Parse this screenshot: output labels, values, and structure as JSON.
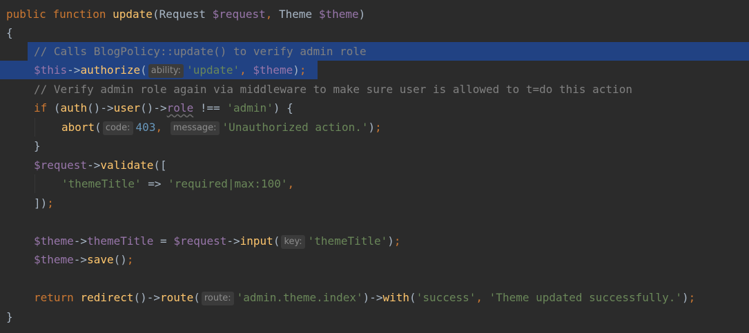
{
  "editor": {
    "lines": {
      "l1": {
        "kw_public": "public",
        "kw_function": "function",
        "fn_update": "update",
        "open_paren": "(",
        "type_request": "Request",
        "var_request": "$request",
        "comma": ",",
        "type_theme": "Theme",
        "var_theme": "$theme",
        "close_paren": ")"
      },
      "l2": {
        "brace": "{"
      },
      "l3": {
        "comment": "// Calls BlogPolicy::update() to verify admin role"
      },
      "l4": {
        "var_this": "$this",
        "arrow": "->",
        "fn_authorize": "authorize",
        "open": "(",
        "hint_ability": "ability:",
        "str_update": "'update'",
        "comma": ",",
        "var_theme": "$theme",
        "close": ")",
        "semi": ";"
      },
      "l5": {
        "comment": "// Verify admin role again via middleware to make sure user is allowed to t=do this action"
      },
      "l6": {
        "kw_if": "if",
        "open": "(",
        "fn_auth": "auth",
        "parens1": "()",
        "arrow1": "->",
        "fn_user": "user",
        "parens2": "()",
        "arrow2": "->",
        "prop_role": "role",
        "op": "!==",
        "str_admin": "'admin'",
        "close": ")",
        "brace": "{"
      },
      "l7": {
        "fn_abort": "abort",
        "open": "(",
        "hint_code": "code:",
        "num_403": "403",
        "comma": ",",
        "hint_message": "message:",
        "str_msg": "'Unauthorized action.'",
        "close": ")",
        "semi": ";"
      },
      "l8": {
        "brace": "}"
      },
      "l9": {
        "var_request": "$request",
        "arrow": "->",
        "fn_validate": "validate",
        "open": "(["
      },
      "l10": {
        "str_key": "'themeTitle'",
        "op": "=>",
        "str_val": "'required|max:100'",
        "comma": ","
      },
      "l11": {
        "close": "])",
        "semi": ";"
      },
      "l13": {
        "var_theme": "$theme",
        "arrow1": "->",
        "prop_title": "themeTitle",
        "eq": "=",
        "var_request": "$request",
        "arrow2": "->",
        "fn_input": "input",
        "open": "(",
        "hint_key": "key:",
        "str_key": "'themeTitle'",
        "close": ")",
        "semi": ";"
      },
      "l14": {
        "var_theme": "$theme",
        "arrow": "->",
        "fn_save": "save",
        "parens": "()",
        "semi": ";"
      },
      "l16": {
        "kw_return": "return",
        "fn_redirect": "redirect",
        "parens": "()",
        "arrow1": "->",
        "fn_route": "route",
        "open1": "(",
        "hint_route": "route:",
        "str_route": "'admin.theme.index'",
        "close1": ")",
        "arrow2": "->",
        "fn_with": "with",
        "open2": "(",
        "str_success": "'success'",
        "comma": ",",
        "str_msg": "'Theme updated successfully.'",
        "close2": ")",
        "semi": ";"
      },
      "l17": {
        "brace": "}"
      }
    },
    "colors": {
      "background": "#2b2b2b",
      "selection": "#214283",
      "keyword": "#cc7832",
      "function": "#ffc66d",
      "variable": "#9876aa",
      "string": "#6a8759",
      "number": "#6897bb",
      "comment": "#808080",
      "plain": "#a9b7c6",
      "hint_bg": "#3b3b3b",
      "hint_fg": "#8c8c8c"
    }
  }
}
